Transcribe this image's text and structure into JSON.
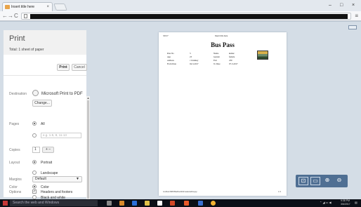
{
  "browser": {
    "tab_title": "Insert title here",
    "tab_close": "×",
    "window_controls": [
      "–",
      "□",
      "×"
    ],
    "nav": {
      "back": "←",
      "forward": "→",
      "reload": "C",
      "home": "⌂"
    },
    "menu": "≡"
  },
  "print": {
    "title": "Print",
    "total": "Total: 1 sheet of paper",
    "print_button": "Print",
    "cancel_button": "Cancel",
    "destination_label": "Destination",
    "destination_value": "Microsoft Print to PDF",
    "change_button": "Change...",
    "pages_label": "Pages",
    "pages_all": "All",
    "pages_placeholder": "e.g. 1-5, 8, 11-13",
    "copies_label": "Copies",
    "copies_value": "1",
    "copies_stepper": "+ –",
    "layout_label": "Layout",
    "layout_portrait": "Portrait",
    "layout_landscape": "Landscape",
    "color_label": "Color",
    "color_color": "Color",
    "color_bw": "Black and white",
    "margins_label": "Margins",
    "margins_value": "Default",
    "options_label": "Options",
    "options_headers": "Headers and footers",
    "scroll_up": "▲",
    "scroll_down": "▼"
  },
  "preview": {
    "date": "3/6/17",
    "header": "Insert title here",
    "heading": "Bus Pass",
    "left_labels": [
      "Pass No",
      "Age",
      "Address",
      "From Date"
    ],
    "left_values": [
      "3",
      "23",
      "c h halkey",
      "04-3-2017"
    ],
    "right_labels": [
      "Name",
      "Gender",
      "Fair",
      "To Date"
    ],
    "right_values": [
      "kumar",
      "female",
      "230",
      "07-3-2017"
    ],
    "footer": "localhost:8080/BusPass/html/GeneratePass.jsp",
    "page_number": "1/1"
  },
  "zoom": {
    "fit": "⊡",
    "fit_width": "▭",
    "zoom_in": "⊕",
    "zoom_out": "⊖"
  },
  "taskbar": {
    "search_placeholder": "Search the web and Windows",
    "time": "9:38 PM",
    "date": "3/6/2017"
  }
}
